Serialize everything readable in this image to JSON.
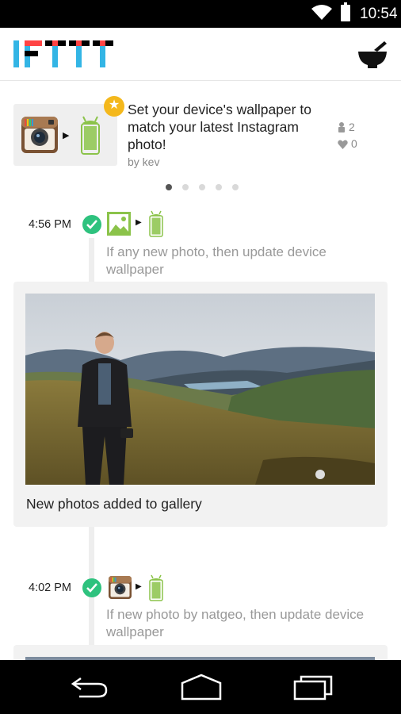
{
  "status_bar": {
    "time": "10:54",
    "wifi_icon": "wifi-icon",
    "battery_icon": "battery-icon"
  },
  "app_bar": {
    "logo_text": "IFTTT",
    "logo_icon": "ifttt-logo",
    "action_icon": "mortar-pestle-icon"
  },
  "featured": {
    "title": "Set your device's wallpaper to match your latest Instagram photo!",
    "author": "by kev",
    "users_count": "2",
    "favorites_count": "0",
    "trigger_icon": "instagram-icon",
    "action_icon": "android-device-icon",
    "badge_icon": "star-icon",
    "page_dots": 5,
    "active_dot": 1
  },
  "timeline": [
    {
      "time": "4:56 PM",
      "status_icon": "checkmark-icon",
      "trigger_icon": "photo-gallery-icon",
      "action_icon": "android-device-icon",
      "description": "If any new photo, then update device wallpaper",
      "card_caption": "New photos added to gallery"
    },
    {
      "time": "4:02 PM",
      "status_icon": "checkmark-icon",
      "trigger_icon": "instagram-icon",
      "action_icon": "android-device-icon",
      "description": "If new photo by natgeo, then update device wallpaper"
    }
  ],
  "colors": {
    "accent_green": "#2ec27e",
    "android_green": "#8bc34a",
    "star_yellow": "#f4b81c"
  },
  "nav_bar": {
    "back_icon": "back-icon",
    "home_icon": "home-icon",
    "recents_icon": "recents-icon"
  }
}
